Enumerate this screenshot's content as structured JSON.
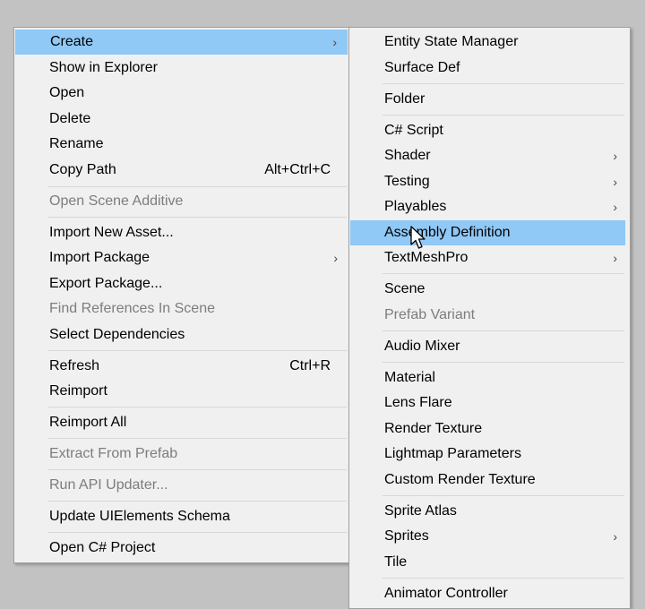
{
  "main_menu": {
    "create": "Create",
    "show_in_explorer": "Show in Explorer",
    "open": "Open",
    "delete": "Delete",
    "rename": "Rename",
    "copy_path": "Copy Path",
    "copy_path_shortcut": "Alt+Ctrl+C",
    "open_scene_additive": "Open Scene Additive",
    "import_new_asset": "Import New Asset...",
    "import_package": "Import Package",
    "export_package": "Export Package...",
    "find_references": "Find References In Scene",
    "select_dependencies": "Select Dependencies",
    "refresh": "Refresh",
    "refresh_shortcut": "Ctrl+R",
    "reimport": "Reimport",
    "reimport_all": "Reimport All",
    "extract_from_prefab": "Extract From Prefab",
    "run_api_updater": "Run API Updater...",
    "update_uielements_schema": "Update UIElements Schema",
    "open_csharp_project": "Open C# Project"
  },
  "sub_menu": {
    "entity_state_manager": "Entity State Manager",
    "surface_def": "Surface Def",
    "folder": "Folder",
    "csharp_script": "C# Script",
    "shader": "Shader",
    "testing": "Testing",
    "playables": "Playables",
    "assembly_definition": "Assembly Definition",
    "textmeshpro": "TextMeshPro",
    "scene": "Scene",
    "prefab_variant": "Prefab Variant",
    "audio_mixer": "Audio Mixer",
    "material": "Material",
    "lens_flare": "Lens Flare",
    "render_texture": "Render Texture",
    "lightmap_parameters": "Lightmap Parameters",
    "custom_render_texture": "Custom Render Texture",
    "sprite_atlas": "Sprite Atlas",
    "sprites": "Sprites",
    "tile": "Tile",
    "animator_controller": "Animator Controller"
  },
  "colors": {
    "highlight": "#90c8f6",
    "menu_bg": "#f0f0f0",
    "disabled_text": "#7d7d7d",
    "desktop_bg": "#c2c2c2"
  },
  "icons": {
    "submenu_arrow": "chevron-right-icon",
    "cursor": "mouse-pointer-icon"
  }
}
